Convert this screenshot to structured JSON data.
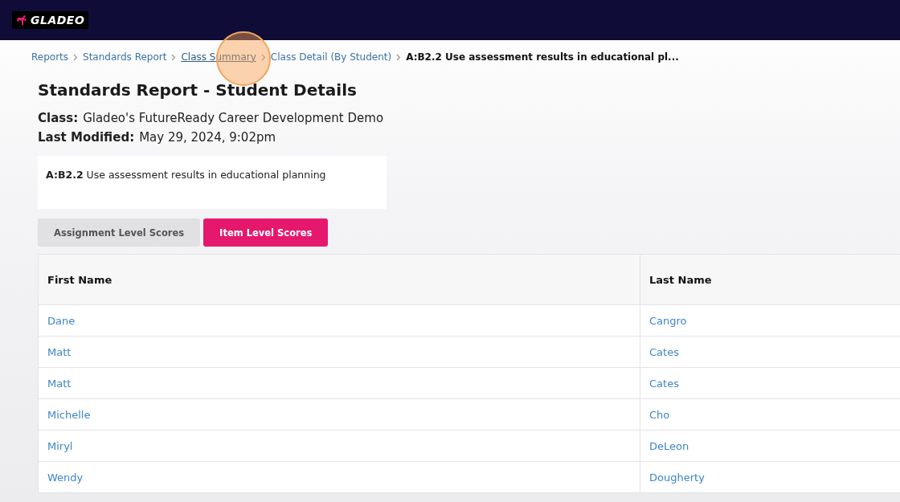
{
  "header": {
    "logo_text": "GLADEO"
  },
  "breadcrumbs": [
    {
      "label": "Reports",
      "kind": "link",
      "hovered": false
    },
    {
      "label": "Standards Report",
      "kind": "link",
      "hovered": false
    },
    {
      "label": "Class Summary",
      "kind": "link",
      "hovered": true
    },
    {
      "label": "Class Detail (By Student)",
      "kind": "link",
      "hovered": false
    },
    {
      "label": "A:B2.2 Use assessment results in educational pl...",
      "kind": "current"
    }
  ],
  "title": "Standards Report - Student Details",
  "meta": [
    {
      "label": "Class:",
      "value": "Gladeo's FutureReady Career Development Demo"
    },
    {
      "label": "Last Modified:",
      "value": "May 29, 2024, 9:02pm"
    }
  ],
  "standard": {
    "code": "A:B2.2",
    "description": "Use assessment results in educational planning"
  },
  "tabs": [
    {
      "label": "Assignment Level Scores",
      "selected": false
    },
    {
      "label": "Item Level Scores",
      "selected": true
    }
  ],
  "table": {
    "columns": [
      "First Name",
      "Last Name"
    ],
    "rows": [
      [
        "Dane",
        "Cangro"
      ],
      [
        "Matt",
        "Cates"
      ],
      [
        "Matt",
        "Cates"
      ],
      [
        "Michelle",
        "Cho"
      ],
      [
        "Miryl",
        "DeLeon"
      ],
      [
        "Wendy",
        "Dougherty"
      ]
    ]
  }
}
